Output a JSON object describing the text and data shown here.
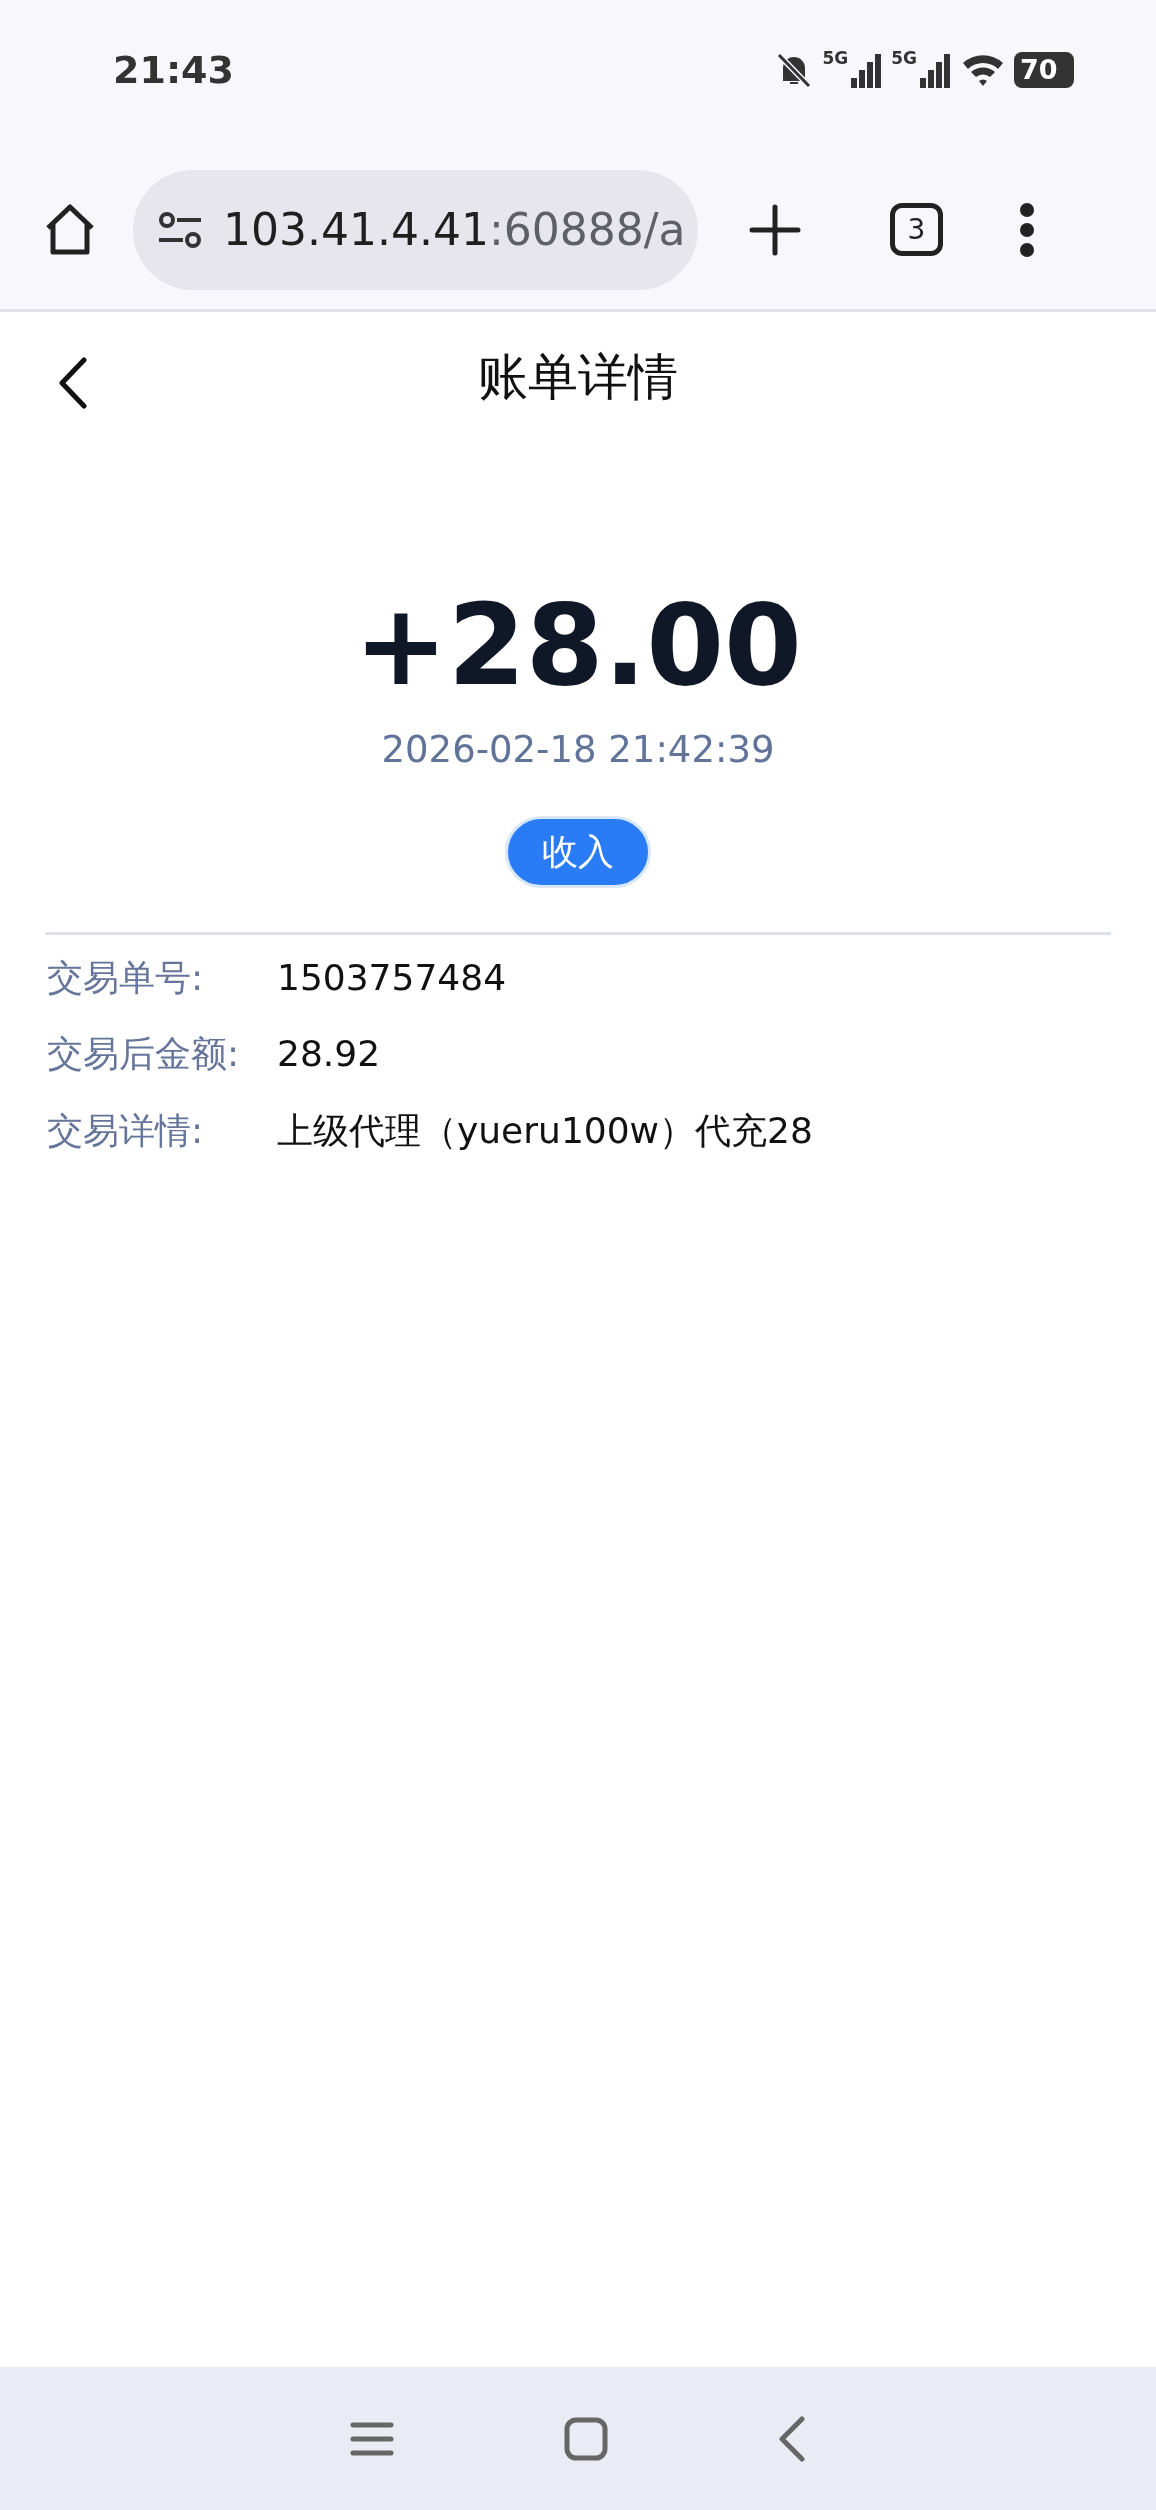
{
  "status_bar": {
    "time": "21:43",
    "signals": [
      {
        "label": "5G"
      },
      {
        "label": "5G"
      }
    ],
    "battery": "70"
  },
  "browser": {
    "url_host": "103.41.4.41",
    "url_path": ":60888/a",
    "tab_count": "3"
  },
  "page": {
    "title": "账单详情",
    "amount": "+28.00",
    "time": "2026-02-18 21:42:39",
    "type_badge": "收入",
    "details": [
      {
        "label": "交易单号:",
        "value": "1503757484"
      },
      {
        "label": "交易后金额:",
        "value": "28.92"
      },
      {
        "label": "交易详情:",
        "value": "上级代理（yueru100w）代充28"
      }
    ]
  }
}
